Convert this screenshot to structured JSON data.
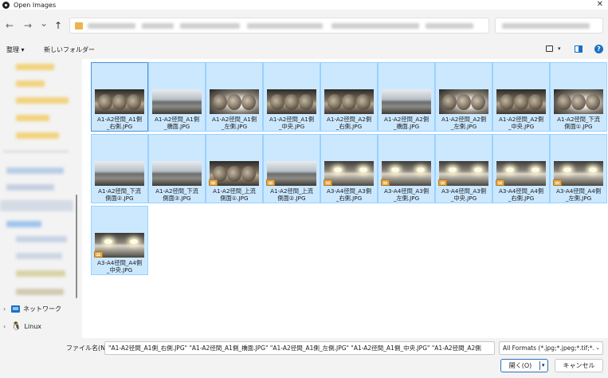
{
  "window": {
    "title": "Open Images",
    "close_glyph": "✕"
  },
  "nav": {
    "back_glyph": "←",
    "forward_glyph": "→",
    "recent_glyph": "⌄",
    "up_glyph": "↑"
  },
  "toolbar": {
    "organize_label": "整理 ▾",
    "new_folder_label": "新しいフォルダー",
    "view_caret": "▾",
    "help_glyph": "?"
  },
  "sidebar": {
    "network_label": "ネットワーク",
    "linux_label": "Linux",
    "chevron_glyph": "›",
    "linux_glyph": "🐧"
  },
  "files": [
    {
      "name": "A1-A2径間_A1側_右側.JPG",
      "lines": [
        "A1-A2径間_A1側",
        "_右側.JPG"
      ],
      "style": "dark",
      "badge": false
    },
    {
      "name": "A1-A2径間_A1側_橋面.JPG",
      "lines": [
        "A1-A2径間_A1側",
        "_橋面.JPG"
      ],
      "style": "road",
      "badge": false
    },
    {
      "name": "A1-A2径間_A1側_左側.JPG",
      "lines": [
        "A1-A2径間_A1側",
        "_左側.JPG"
      ],
      "style": "bright",
      "badge": false
    },
    {
      "name": "A1-A2径間_A1側_中央.JPG",
      "lines": [
        "A1-A2径間_A1側",
        "_中央.JPG"
      ],
      "style": "dark",
      "badge": false
    },
    {
      "name": "A1-A2径間_A2側_右側.JPG",
      "lines": [
        "A1-A2径間_A2側",
        "_右側.JPG"
      ],
      "style": "dark",
      "badge": false
    },
    {
      "name": "A1-A2径間_A2側_橋面.JPG",
      "lines": [
        "A1-A2径間_A2側",
        "_橋面.JPG"
      ],
      "style": "road",
      "badge": false
    },
    {
      "name": "A1-A2径間_A2側_左側.JPG",
      "lines": [
        "A1-A2径間_A2側",
        "_左側.JPG"
      ],
      "style": "bright",
      "badge": false
    },
    {
      "name": "A1-A2径間_A2側_中央.JPG",
      "lines": [
        "A1-A2径間_A2側",
        "_中央.JPG"
      ],
      "style": "dark",
      "badge": false
    },
    {
      "name": "A1-A2径間_下流側面①.JPG",
      "lines": [
        "A1-A2径間_下流",
        "側面①.JPG"
      ],
      "style": "bright",
      "badge": false
    },
    {
      "name": "A1-A2径間_下流側面②.JPG",
      "lines": [
        "A1-A2径間_下流",
        "側面②.JPG"
      ],
      "style": "road",
      "badge": false
    },
    {
      "name": "A1-A2径間_下流側面③.JPG",
      "lines": [
        "A1-A2径間_下流",
        "側面③.JPG"
      ],
      "style": "road",
      "badge": false
    },
    {
      "name": "A1-A2径間_上流側面①.JPG",
      "lines": [
        "A1-A2径間_上流",
        "側面①.JPG"
      ],
      "style": "dark",
      "badge": true
    },
    {
      "name": "A1-A2径間_上流側面②.JPG",
      "lines": [
        "A1-A2径間_上流",
        "側面②.JPG"
      ],
      "style": "road",
      "badge": true
    },
    {
      "name": "A3-A4径間_A3側_右側.JPG",
      "lines": [
        "A3-A4径間_A3側",
        "_右側.JPG"
      ],
      "style": "sun",
      "badge": true
    },
    {
      "name": "A3-A4径間_A3側_左側.JPG",
      "lines": [
        "A3-A4径間_A3側",
        "_左側.JPG"
      ],
      "style": "sun",
      "badge": true
    },
    {
      "name": "A3-A4径間_A3側_中央.JPG",
      "lines": [
        "A3-A4径間_A3側",
        "_中央.JPG"
      ],
      "style": "sun",
      "badge": true
    },
    {
      "name": "A3-A4径間_A4側_右側.JPG",
      "lines": [
        "A3-A4径間_A4側",
        "_右側.JPG"
      ],
      "style": "sun",
      "badge": true
    },
    {
      "name": "A3-A4径間_A4側_左側.JPG",
      "lines": [
        "A3-A4径間_A4側",
        "_左側.JPG"
      ],
      "style": "sun",
      "badge": true
    },
    {
      "name": "A3-A4径間_A4側_中央.JPG",
      "lines": [
        "A3-A4径間_A4側",
        "_中央.JPG"
      ],
      "style": "sun",
      "badge": true
    }
  ],
  "footer": {
    "filename_label": "ファイル名(N):",
    "filename_value": "\"A1-A2径間_A1側_右側.JPG\" \"A1-A2径間_A1側_橋面.JPG\" \"A1-A2径間_A1側_左側.JPG\" \"A1-A2径間_A1側_中央.JPG\" \"A1-A2径間_A2側",
    "filter_value": "All Formats (*.jpg;*.jpeg;*.tif;*.ti",
    "filter_caret": "⌄",
    "open_label": "開く(O)",
    "open_caret": "▾",
    "cancel_label": "キャンセル"
  },
  "colors": {
    "selection_fill": "#cce8ff",
    "selection_border": "#99d1ff",
    "accent": "#1c6fc7",
    "folder": "#e9b54c"
  }
}
